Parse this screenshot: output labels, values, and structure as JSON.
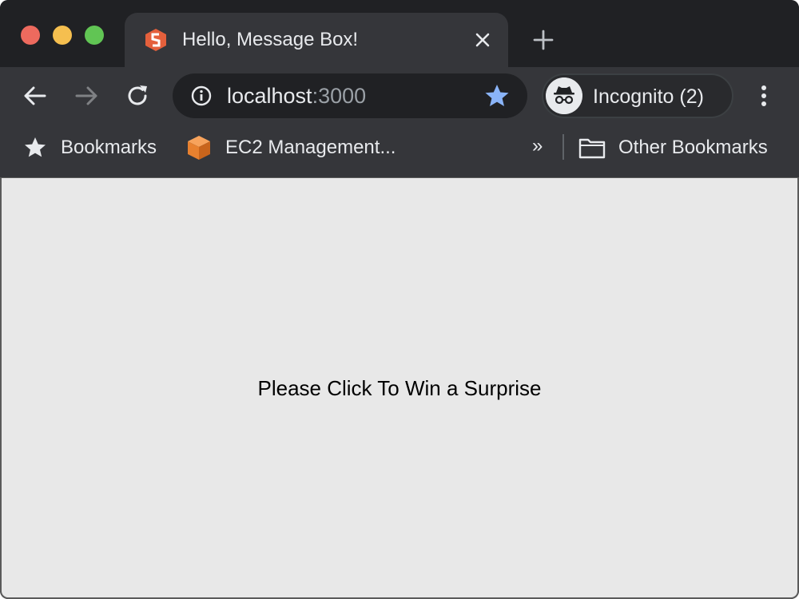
{
  "window": {
    "traffic_lights": {
      "close": "#ed6a5e",
      "minimize": "#f5bf4f",
      "maximize": "#61c554"
    }
  },
  "tab": {
    "title": "Hello, Message Box!",
    "favicon": "framework-logo-icon",
    "favicon_color": "#e4603c"
  },
  "toolbar": {
    "url_host": "localhost",
    "url_port": ":3000",
    "star_color": "#8ab4f8",
    "incognito_label": "Incognito (2)"
  },
  "bookmarks": {
    "items": [
      {
        "label": "Bookmarks",
        "icon": "star-icon"
      },
      {
        "label": "EC2 Management...",
        "icon": "aws-cube-icon"
      }
    ],
    "overflow": "»",
    "other": {
      "label": "Other Bookmarks",
      "icon": "folder-icon"
    }
  },
  "page": {
    "message": "Please Click To Win a Surprise",
    "background": "#e8e8e8"
  }
}
